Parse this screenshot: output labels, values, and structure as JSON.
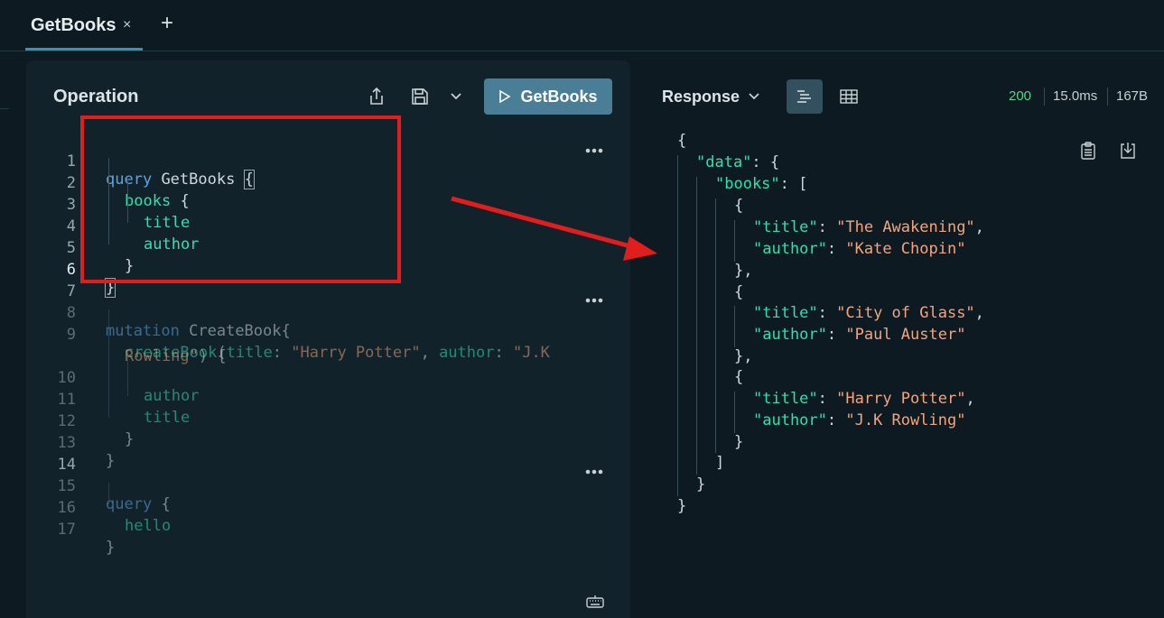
{
  "tabs": [
    {
      "title": "GetBooks",
      "close": "×"
    }
  ],
  "tab_add": "+",
  "operation": {
    "title": "Operation",
    "run_label": "GetBooks",
    "code_lines": [
      {
        "n": "1",
        "text": ""
      },
      {
        "n": "2",
        "text": ""
      },
      {
        "n": "3",
        "text": ""
      },
      {
        "n": "4",
        "text": ""
      },
      {
        "n": "5",
        "text": ""
      },
      {
        "n": "6",
        "text": ""
      },
      {
        "n": "7",
        "text": ""
      },
      {
        "n": "8",
        "text": ""
      },
      {
        "n": "9",
        "text": ""
      },
      {
        "n": "10",
        "text": ""
      },
      {
        "n": "11",
        "text": ""
      },
      {
        "n": "12",
        "text": ""
      },
      {
        "n": "13",
        "text": ""
      },
      {
        "n": "14",
        "text": ""
      },
      {
        "n": "15",
        "text": ""
      },
      {
        "n": "16",
        "text": ""
      },
      {
        "n": "17",
        "text": ""
      }
    ],
    "tokens": {
      "query": "query",
      "getbooks": "GetBooks",
      "brace_open": "{",
      "brace_close": "}",
      "books": "books",
      "title": "title",
      "author": "author",
      "mutation": "mutation",
      "createbook_name": "CreateBook",
      "createbook_field": "createBook",
      "arg_title": "title",
      "arg_author": "author",
      "val_title": "\"Harry Potter\"",
      "val_author_part1": "\"J.K",
      "val_author_part2": "Rowling\"",
      "hello": "hello"
    },
    "more_icon": "more-horizontal-icon"
  },
  "response": {
    "title": "Response",
    "status_code": "200",
    "time": "15.0ms",
    "size": "167B",
    "status_color": "#4fd68a",
    "json_keys": {
      "data": "\"data\"",
      "books": "\"books\"",
      "title": "\"title\"",
      "author": "\"author\""
    },
    "books": [
      {
        "title": "\"The Awakening\"",
        "author": "\"Kate Chopin\""
      },
      {
        "title": "\"City of Glass\"",
        "author": "\"Paul Auster\""
      },
      {
        "title": "\"Harry Potter\"",
        "author": "\"J.K Rowling\""
      }
    ]
  },
  "annotation_color": "#e01e1e"
}
